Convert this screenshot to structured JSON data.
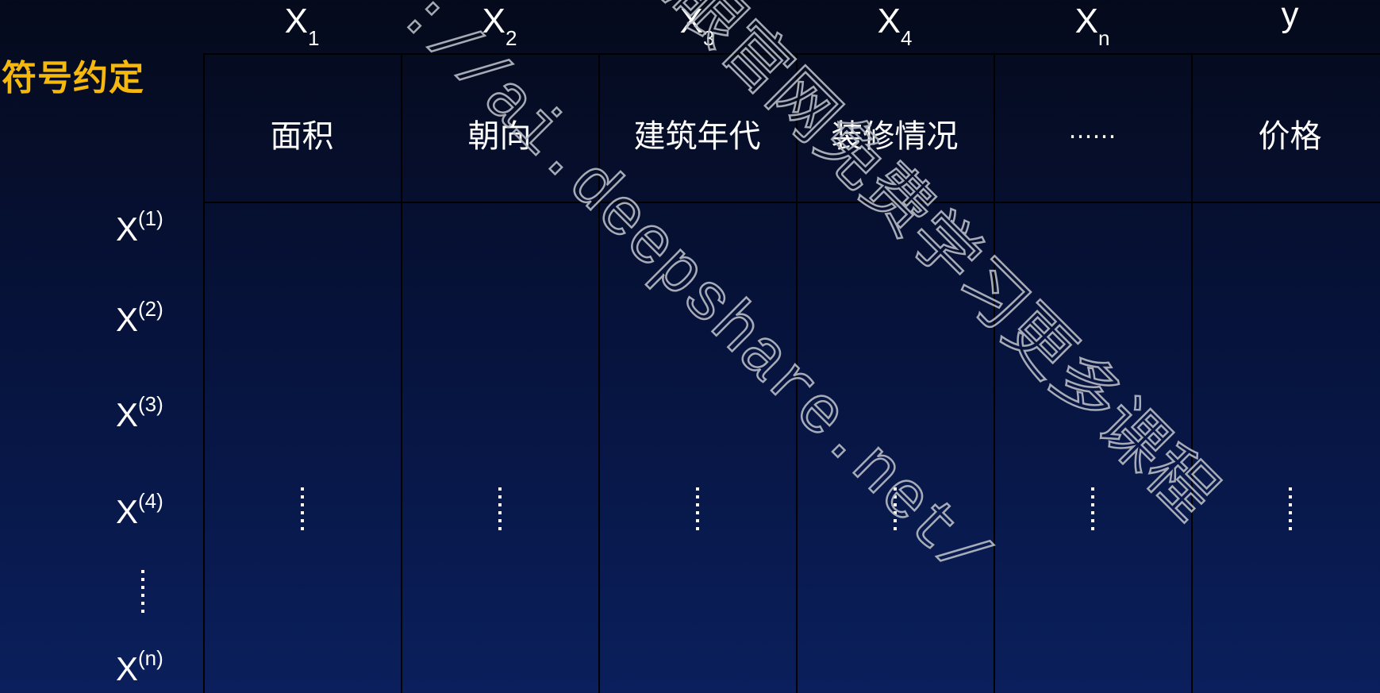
{
  "title": "符号约定",
  "variables": [
    {
      "base": "X",
      "sub": "1"
    },
    {
      "base": "X",
      "sub": "2"
    },
    {
      "base": "X",
      "sub": "3"
    },
    {
      "base": "X",
      "sub": "4"
    },
    {
      "base": "X",
      "sub": "n"
    },
    {
      "base": "y",
      "sub": ""
    }
  ],
  "features": [
    "面积",
    "朝向",
    "建筑年代",
    "装修情况",
    "……",
    "价格"
  ],
  "samples": [
    {
      "base": "X",
      "sup": "(1)"
    },
    {
      "base": "X",
      "sup": "(2)"
    },
    {
      "base": "X",
      "sup": "(3)"
    },
    {
      "base": "X",
      "sup": "(4)"
    },
    {
      "base": "X",
      "sup": "(n)"
    }
  ],
  "watermark": {
    "url": "://ai.deepshare.net/",
    "text": "之眼官网免费学习更多课程",
    "color": "#b8bcc4"
  }
}
